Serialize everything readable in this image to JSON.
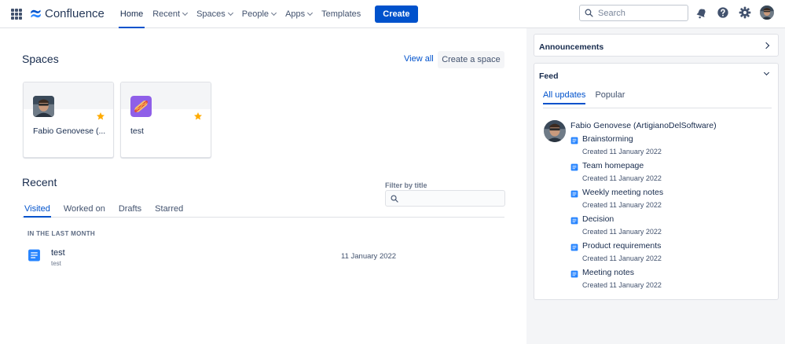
{
  "topnav": {
    "brand": "Confluence",
    "items": [
      {
        "label": "Home",
        "active": true,
        "dropdown": false
      },
      {
        "label": "Recent",
        "active": false,
        "dropdown": true
      },
      {
        "label": "Spaces",
        "active": false,
        "dropdown": true
      },
      {
        "label": "People",
        "active": false,
        "dropdown": true
      },
      {
        "label": "Apps",
        "active": false,
        "dropdown": true
      },
      {
        "label": "Templates",
        "active": false,
        "dropdown": false
      }
    ],
    "create_label": "Create",
    "search_placeholder": "Search",
    "icons": [
      "app-switcher-icon",
      "notification-bell-icon",
      "help-icon",
      "settings-gear-icon",
      "user-avatar"
    ]
  },
  "spaces": {
    "title": "Spaces",
    "view_all": "View all",
    "create_space": "Create a space",
    "cards": [
      {
        "name": "Fabio Genovese (...",
        "starred": true,
        "avatar": "person-photo"
      },
      {
        "name": "test",
        "starred": true,
        "avatar": "hotdog-icon"
      }
    ]
  },
  "recent": {
    "title": "Recent",
    "filter_label": "Filter by title",
    "tabs": [
      "Visited",
      "Worked on",
      "Drafts",
      "Starred"
    ],
    "active_tab": "Visited",
    "section_label": "IN THE LAST MONTH",
    "items": [
      {
        "title": "test",
        "space": "test",
        "date": "11 January 2022"
      }
    ]
  },
  "sidebar": {
    "announcements": "Announcements",
    "feed": {
      "title": "Feed",
      "tabs": [
        "All updates",
        "Popular"
      ],
      "active_tab": "All updates",
      "user": "Fabio Genovese (ArtigianoDelSoftware)",
      "items": [
        {
          "title": "Brainstorming",
          "meta": "Created 11 January 2022"
        },
        {
          "title": "Team homepage",
          "meta": "Created 11 January 2022"
        },
        {
          "title": "Weekly meeting notes",
          "meta": "Created 11 January 2022"
        },
        {
          "title": "Decision",
          "meta": "Created 11 January 2022"
        },
        {
          "title": "Product requirements",
          "meta": "Created 11 January 2022"
        },
        {
          "title": "Meeting notes",
          "meta": "Created 11 January 2022"
        }
      ]
    }
  },
  "colors": {
    "accent": "#0052cc",
    "star": "#ffab00",
    "doc": "#2684ff"
  }
}
